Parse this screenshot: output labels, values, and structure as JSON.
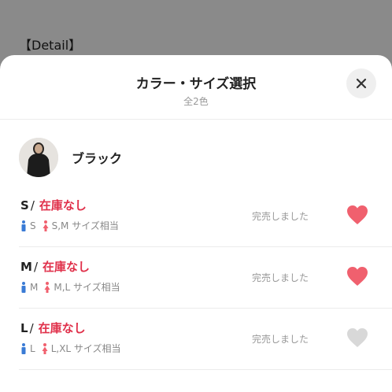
{
  "backdrop": {
    "text": "【Detail】"
  },
  "sheet": {
    "title": "カラー・サイズ選択",
    "subtitle": "全2色",
    "close_icon": "close-icon"
  },
  "color": {
    "name": "ブラック",
    "thumbnail_icon": "product-thumbnail"
  },
  "sizes": [
    {
      "label": "S",
      "slash": "/",
      "status": "在庫なし",
      "male_size": "S",
      "female_size": "S,M サイズ相当",
      "sold_text": "完売しました",
      "favorite_color": "#f0606e"
    },
    {
      "label": "M",
      "slash": "/",
      "status": "在庫なし",
      "male_size": "M",
      "female_size": "M,L サイズ相当",
      "sold_text": "完売しました",
      "favorite_color": "#f0606e"
    },
    {
      "label": "L",
      "slash": "/",
      "status": "在庫なし",
      "male_size": "L",
      "female_size": "L,XL サイズ相当",
      "sold_text": "完売しました",
      "favorite_color": "#d8d8d8"
    }
  ],
  "colors": {
    "accent_red": "#e0304a",
    "male_icon": "#3a7bd5",
    "female_icon": "#f0606e"
  }
}
